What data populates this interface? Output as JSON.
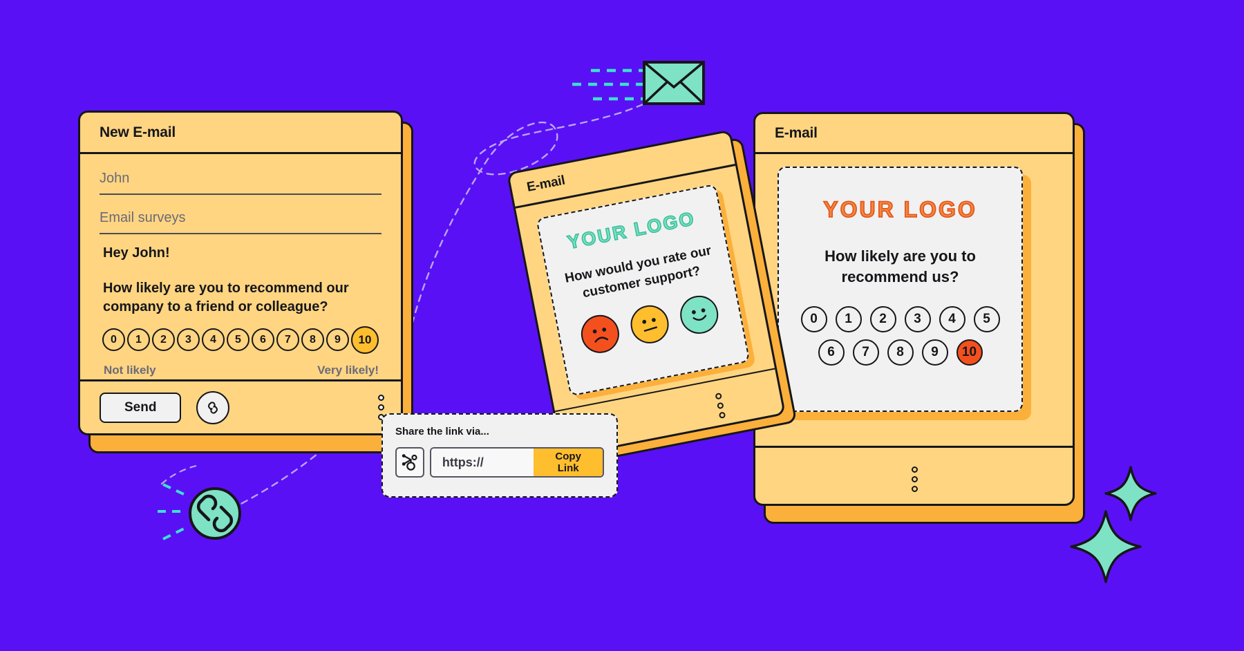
{
  "theme": {
    "background": "#5A10F5",
    "card_bg": "#FFD581",
    "card_shadow": "#FBB03B",
    "ink": "#16161a",
    "preview_bg": "#F1F1F1",
    "accent_amber": "#FFBE2E",
    "accent_orange": "#F4501E",
    "accent_mint": "#7EE2C4"
  },
  "compose_card": {
    "title": "New E-mail",
    "recipient": "John",
    "subject": "Email surveys",
    "greeting": "Hey John!",
    "question": "How likely are you to recommend our company to a friend or colleague?",
    "scale": [
      "0",
      "1",
      "2",
      "3",
      "4",
      "5",
      "6",
      "7",
      "8",
      "9",
      "10"
    ],
    "selected": "10",
    "low_label": "Not likely",
    "high_label": "Very likely!",
    "send_label": "Send",
    "link_icon": "chain-link-icon",
    "menu_icon": "kebab-menu-icon"
  },
  "tilted_card": {
    "title": "E-mail",
    "logo": "YOUR LOGO",
    "question": "How would you rate our customer support?",
    "faces": [
      {
        "name": "sad-face-icon",
        "color": "#F4501E",
        "mood": "sad"
      },
      {
        "name": "neutral-face-icon",
        "color": "#FFBE2E",
        "mood": "neutral"
      },
      {
        "name": "happy-face-icon",
        "color": "#7EE2C4",
        "mood": "happy"
      }
    ],
    "menu_icon": "kebab-menu-icon"
  },
  "right_card": {
    "title": "E-mail",
    "logo": "YOUR LOGO",
    "question": "How likely are you to recommend us?",
    "scale_row_1": [
      "0",
      "1",
      "2",
      "3",
      "4",
      "5"
    ],
    "scale_row_2": [
      "6",
      "7",
      "8",
      "9",
      "10"
    ],
    "selected": "10",
    "menu_icon": "kebab-menu-icon"
  },
  "share_popup": {
    "title": "Share the link via...",
    "provider_icon": "hubspot-sprocket-icon",
    "url_value": "https://",
    "url_placeholder": "https://",
    "copy_label": "Copy Link"
  },
  "decorations": {
    "envelope_icon": "envelope-icon",
    "link_badge_icon": "chain-link-icon",
    "sparkle_icon": "sparkle-star-icon",
    "sparkle_count": 2
  }
}
